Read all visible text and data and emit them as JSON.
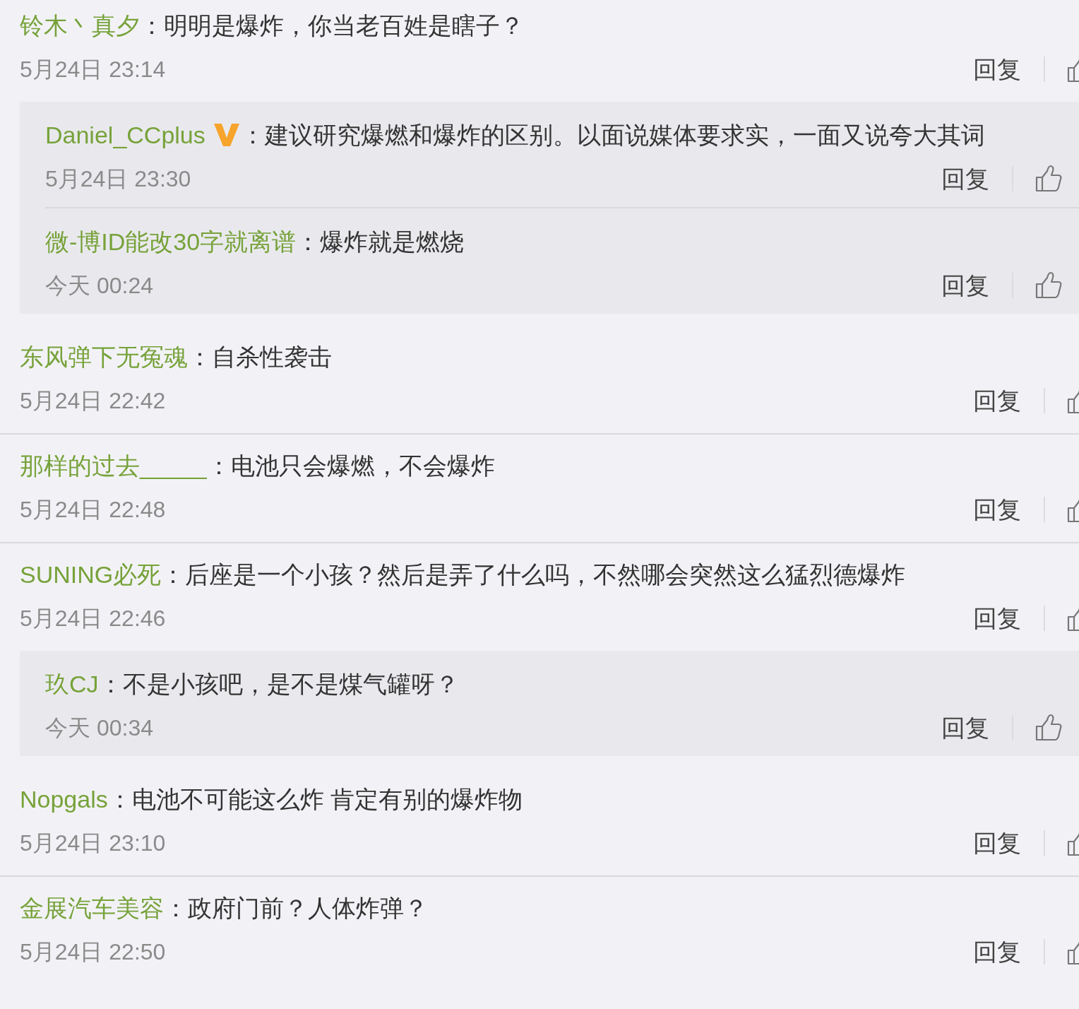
{
  "threads": [
    {
      "author": "铃木丶真夕",
      "verified": false,
      "text": "：明明是爆炸，你当老百姓是瞎子？",
      "time": "5月24日 23:14",
      "reply_label": "回复",
      "replies": [
        {
          "author": "Daniel_CCplus",
          "verified": true,
          "text": "：建议研究爆燃和爆炸的区别。以面说媒体要求实，一面又说夸大其词",
          "time": "5月24日 23:30",
          "reply_label": "回复"
        },
        {
          "author": "微-博ID能改30字就离谱",
          "verified": false,
          "text": "：爆炸就是燃烧",
          "time": "今天 00:24",
          "reply_label": "回复"
        }
      ]
    },
    {
      "author": "东风弹下无冤魂",
      "verified": false,
      "text": "：自杀性袭击",
      "time": "5月24日 22:42",
      "reply_label": "回复"
    },
    {
      "author": "那样的过去_____",
      "verified": false,
      "text": "：电池只会爆燃，不会爆炸",
      "time": "5月24日 22:48",
      "reply_label": "回复"
    },
    {
      "author": "SUNING必死",
      "verified": false,
      "text": "：后座是一个小孩？然后是弄了什么吗，不然哪会突然这么猛烈德爆炸",
      "time": "5月24日 22:46",
      "reply_label": "回复",
      "replies": [
        {
          "author": "玖CJ",
          "verified": false,
          "text": "：不是小孩吧，是不是煤气罐呀？",
          "time": "今天 00:34",
          "reply_label": "回复"
        }
      ]
    },
    {
      "author": "Nopgals",
      "verified": false,
      "text": "：电池不可能这么炸  肯定有别的爆炸物",
      "time": "5月24日 23:10",
      "reply_label": "回复"
    },
    {
      "author": "金展汽车美容",
      "verified": false,
      "text": "：政府门前？人体炸弹？",
      "time": "5月24日 22:50",
      "reply_label": "回复"
    }
  ]
}
